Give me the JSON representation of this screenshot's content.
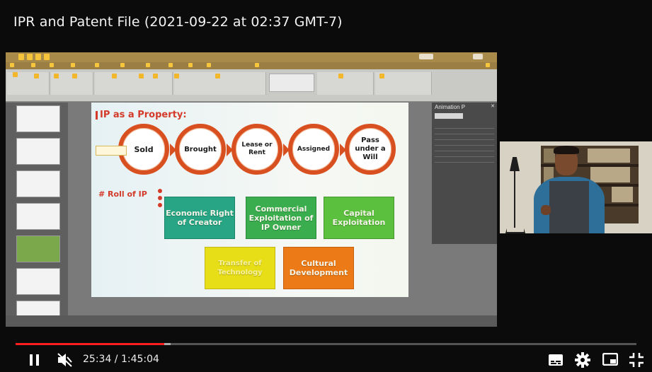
{
  "video": {
    "title": "IPR and Patent File (2021-09-22 at 02:37 GMT-7)"
  },
  "player": {
    "current_time": "25:34",
    "duration": "1:45:04",
    "time_display": "25:34 / 1:45:04",
    "progress_fraction": 0.24,
    "buffered_fraction": 0.25,
    "accent_color": "#ff1e1e"
  },
  "slide": {
    "heading": "IP as a Property:",
    "chain": [
      "Sold",
      "Brought",
      "Lease or Rent",
      "Assigned",
      "Pass under a Will"
    ],
    "roll_heading": "# Roll of IP",
    "boxes": [
      {
        "label": "Economic Right of Creator",
        "color": "#27a584"
      },
      {
        "label": "Commercial Exploitation of IP Owner",
        "color": "#3aae4e"
      },
      {
        "label": "Capital Exploitation",
        "color": "#5cc03f"
      },
      {
        "label": "Transfer of Technology",
        "color": "#e8de18"
      },
      {
        "label": "Cultural Development",
        "color": "#ec7a16"
      }
    ]
  },
  "animation_pane": {
    "title": "Animation P"
  },
  "icons": {
    "play_pause": "pause-icon",
    "volume": "volume-muted-icon",
    "captions": "captions-icon",
    "settings": "gear-icon",
    "miniplayer": "miniplayer-icon",
    "fullscreen": "exit-fullscreen-icon"
  }
}
